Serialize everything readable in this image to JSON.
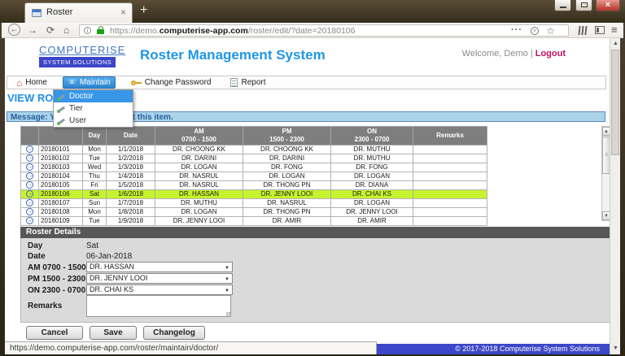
{
  "browser": {
    "tab_title": "Roster",
    "new_tab_label": "+",
    "url_prefix": "https://demo.",
    "url_domain": "computerise-app.com",
    "url_path": "/roster/edit/?date=20180106",
    "status_link": "https://demo.computerise-app.com/roster/maintain/doctor/"
  },
  "header": {
    "logo_line1": "COMPUTERISE",
    "logo_line2": "SYSTEM SOLUTIONS",
    "app_title": "Roster Management System",
    "welcome_text": "Welcome, Demo",
    "separator": "|",
    "logout_label": "Logout"
  },
  "menu": {
    "items": [
      {
        "label": "Home"
      },
      {
        "label": "Maintain"
      },
      {
        "label": "Change Password"
      },
      {
        "label": "Report"
      }
    ],
    "dropdown": {
      "selected": "Doctor",
      "items": [
        {
          "label": "Doctor"
        },
        {
          "label": "Tier"
        },
        {
          "label": "User"
        }
      ]
    }
  },
  "page": {
    "view_title": "VIEW ROSTER",
    "message": "Message: You have checked out this item."
  },
  "table": {
    "headers": {
      "day": "Day",
      "date": "Date",
      "am_line1": "AM",
      "am_line2": "0700 - 1500",
      "pm_line1": "PM",
      "pm_line2": "1500 - 2300",
      "on_line1": "ON",
      "on_line2": "2300 - 0700",
      "remarks": "Remarks"
    },
    "rows": [
      {
        "id": "20180101",
        "day": "Mon",
        "date": "1/1/2018",
        "am": "DR. CHOONG KK",
        "pm": "DR. CHOONG KK",
        "on": "DR. MUTHU",
        "remarks": ""
      },
      {
        "id": "20180102",
        "day": "Tue",
        "date": "1/2/2018",
        "am": "DR. DARINI",
        "pm": "DR. DARINI",
        "on": "DR. MUTHU",
        "remarks": ""
      },
      {
        "id": "20180103",
        "day": "Wed",
        "date": "1/3/2018",
        "am": "DR. LOGAN",
        "pm": "DR. FONG",
        "on": "DR. FONG",
        "remarks": ""
      },
      {
        "id": "20180104",
        "day": "Thu",
        "date": "1/4/2018",
        "am": "DR. NASRUL",
        "pm": "DR. LOGAN",
        "on": "DR. LOGAN",
        "remarks": ""
      },
      {
        "id": "20180105",
        "day": "Fri",
        "date": "1/5/2018",
        "am": "DR. NASRUL",
        "pm": "DR. THONG PN",
        "on": "DR. DIANA",
        "remarks": ""
      },
      {
        "id": "20180106",
        "day": "Sat",
        "date": "1/6/2018",
        "am": "DR. HASSAN",
        "pm": "DR. JENNY LOOI",
        "on": "DR. CHAI KS",
        "remarks": "",
        "highlighted": true
      },
      {
        "id": "20180107",
        "day": "Sun",
        "date": "1/7/2018",
        "am": "DR. MUTHU",
        "pm": "DR. NASRUL",
        "on": "DR. LOGAN",
        "remarks": ""
      },
      {
        "id": "20180108",
        "day": "Mon",
        "date": "1/8/2018",
        "am": "DR. LOGAN",
        "pm": "DR. THONG PN",
        "on": "DR. JENNY LOOI",
        "remarks": ""
      },
      {
        "id": "20180109",
        "day": "Tue",
        "date": "1/9/2018",
        "am": "DR. JENNY LOOI",
        "pm": "DR. AMIR",
        "on": "DR. AMIR",
        "remarks": ""
      }
    ]
  },
  "details": {
    "title": "Roster Details",
    "day_label": "Day",
    "day_value": "Sat",
    "date_label": "Date",
    "date_value": "06-Jan-2018",
    "am_label": "AM 0700 - 1500",
    "am_value": "DR. HASSAN",
    "pm_label": "PM 1500 - 2300",
    "pm_value": "DR. JENNY LOOI",
    "on_label": "ON 2300 - 0700",
    "on_value": "DR. CHAI KS",
    "remarks_label": "Remarks",
    "remarks_value": "",
    "buttons": [
      {
        "label": "Cancel"
      },
      {
        "label": "Save"
      },
      {
        "label": "Changelog"
      }
    ]
  },
  "footer": {
    "copyright": "© 2017-2018 Computerise System Solutions"
  },
  "colors": {
    "app_title_blue": "#1f96e6",
    "logo_box_blue": "#3c46c8",
    "logout_pink": "#c01060",
    "menu_active_blue": "#3896e8",
    "message_bg": "#abd4e9",
    "message_text": "#235e9e",
    "table_header_gray": "#7e7e7e",
    "highlight_row_green": "#c6f22e",
    "details_header_gray": "#575757",
    "footer_blue": "#3b47c8",
    "lock_green": "#18a018"
  }
}
